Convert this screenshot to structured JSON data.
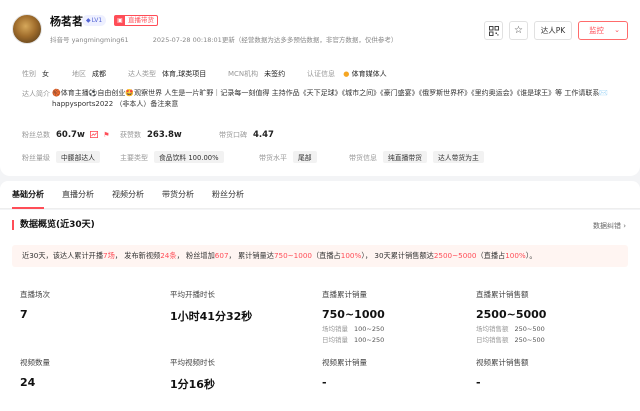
{
  "profile": {
    "name": "杨茗茗",
    "level_badge": "LV1",
    "live_badge": "直播带货",
    "douyin_id_label": "抖音号",
    "douyin_id": "yangmingming61",
    "update_text": "2025-07-28 00:18:01更新（经营数据为达多多预估数据，非官方数据，仅供参考）"
  },
  "actions": {
    "pk_label": "达人PK",
    "monitor_label": "监控"
  },
  "info_row1": [
    {
      "key": "性别",
      "value": "女"
    },
    {
      "key": "地区",
      "value": "成都"
    },
    {
      "key": "达人类型",
      "value": "体育,球类项目"
    },
    {
      "key": "MCN机构",
      "value": "未签约"
    },
    {
      "key": "认证信息",
      "value": "体育媒体人"
    }
  ],
  "intro": {
    "key": "达人简介",
    "text": "🏀体育主播⚽自由创业🤩观察世界 人生是一片旷野｜记录每一刻值得 主持作品《天下足球》《城市之间》《豪门盛宴》《俄罗斯世界杯》《里约奥运会》《谁是球王》等 工作请联系✉️ happysports2022 （非本人）备注来意"
  },
  "fans": {
    "total_label": "粉丝总数",
    "total_value": "60.7w",
    "likes_label": "获赞数",
    "likes_value": "263.8w",
    "sales_label": "带货口碑",
    "sales_value": "4.47"
  },
  "levels": {
    "fans_level_label": "粉丝量级",
    "fans_level_value": "中腰部达人",
    "category_label": "主要类型",
    "category_value": "食品饮料 100.00%",
    "sell_level_label": "带货水平",
    "sell_level_value": "尾部",
    "sell_info_label": "带货信息",
    "sell_info_tags": [
      "纯直播带货",
      "达人带货为主"
    ]
  },
  "tabs": [
    "基础分析",
    "直播分析",
    "视频分析",
    "带货分析",
    "粉丝分析"
  ],
  "overview": {
    "title": "数据概览(近30天)",
    "feedback": "数据纠错",
    "summary": {
      "p1": "近30天，该达人累计开播",
      "live_count": "7场",
      "p2": "， 发布新视频",
      "video_count": "24条",
      "p3": "， 粉丝增加",
      "fans_added": "607",
      "p4": "， 累计销量达",
      "sales": "750~1000",
      "p5": "（直播占",
      "sales_live_pct": "100%",
      "p6": "）， 30天累计销售额达",
      "gmv": "2500~5000",
      "p7": "（直播占",
      "gmv_live_pct": "100%",
      "p8": "）。"
    },
    "stats": {
      "live_sessions": {
        "label": "直播场次",
        "value": "7"
      },
      "avg_live_duration": {
        "label": "平均开播时长",
        "value": "1小时41分32秒"
      },
      "live_sales": {
        "label": "直播累计销量",
        "value": "750~1000",
        "sub1_label": "场均销量",
        "sub1_value": "100~250",
        "sub2_label": "日均销量",
        "sub2_value": "100~250"
      },
      "live_gmv": {
        "label": "直播累计销售额",
        "value": "2500~5000",
        "sub1_label": "场均销售额",
        "sub1_value": "250~500",
        "sub2_label": "日均销售额",
        "sub2_value": "250~500"
      },
      "video_count": {
        "label": "视频数量",
        "value": "24"
      },
      "avg_video_duration": {
        "label": "平均视频时长",
        "value": "1分16秒"
      },
      "video_sales": {
        "label": "视频累计销量",
        "value": "-"
      },
      "video_gmv": {
        "label": "视频累计销售额",
        "value": "-"
      }
    }
  },
  "colors": {
    "accent": "#ff4d57",
    "summary_bg": "#fff5f2"
  }
}
